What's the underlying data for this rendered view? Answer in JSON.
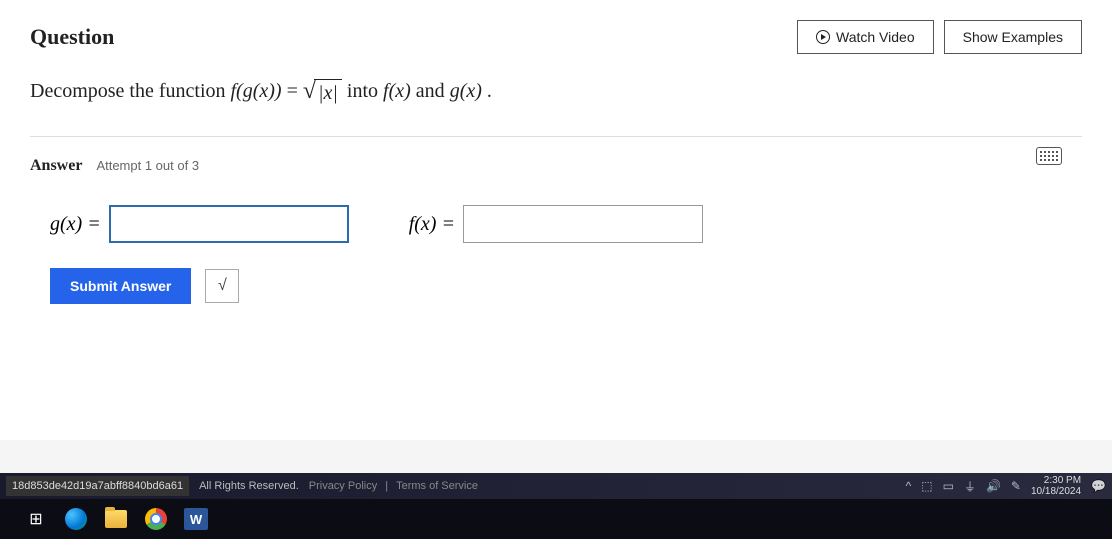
{
  "header": {
    "title": "Question",
    "watch_video": "Watch Video",
    "show_examples": "Show Examples"
  },
  "prompt": {
    "prefix": "Decompose the function ",
    "composite": "f(g(x))",
    "equals": " = ",
    "sqrt_arg": "|x|",
    "middle": " into ",
    "f": "f(x)",
    "and": " and ",
    "g": "g(x)",
    "suffix": "."
  },
  "answer": {
    "label": "Answer",
    "attempt": "Attempt 1 out of 3",
    "g_label": "g(x) =",
    "g_value": "",
    "f_label": "f(x) =",
    "f_value": "",
    "submit": "Submit Answer",
    "sqrt_tool": "√"
  },
  "footer": {
    "hash": "18d853de42d19a7abff8840bd6a61",
    "rights": "All Rights Reserved.",
    "privacy": "Privacy Policy",
    "terms": "Terms of Service",
    "time": "2:30 PM",
    "date": "10/18/2024"
  },
  "taskbar": {
    "word_letter": "W"
  }
}
